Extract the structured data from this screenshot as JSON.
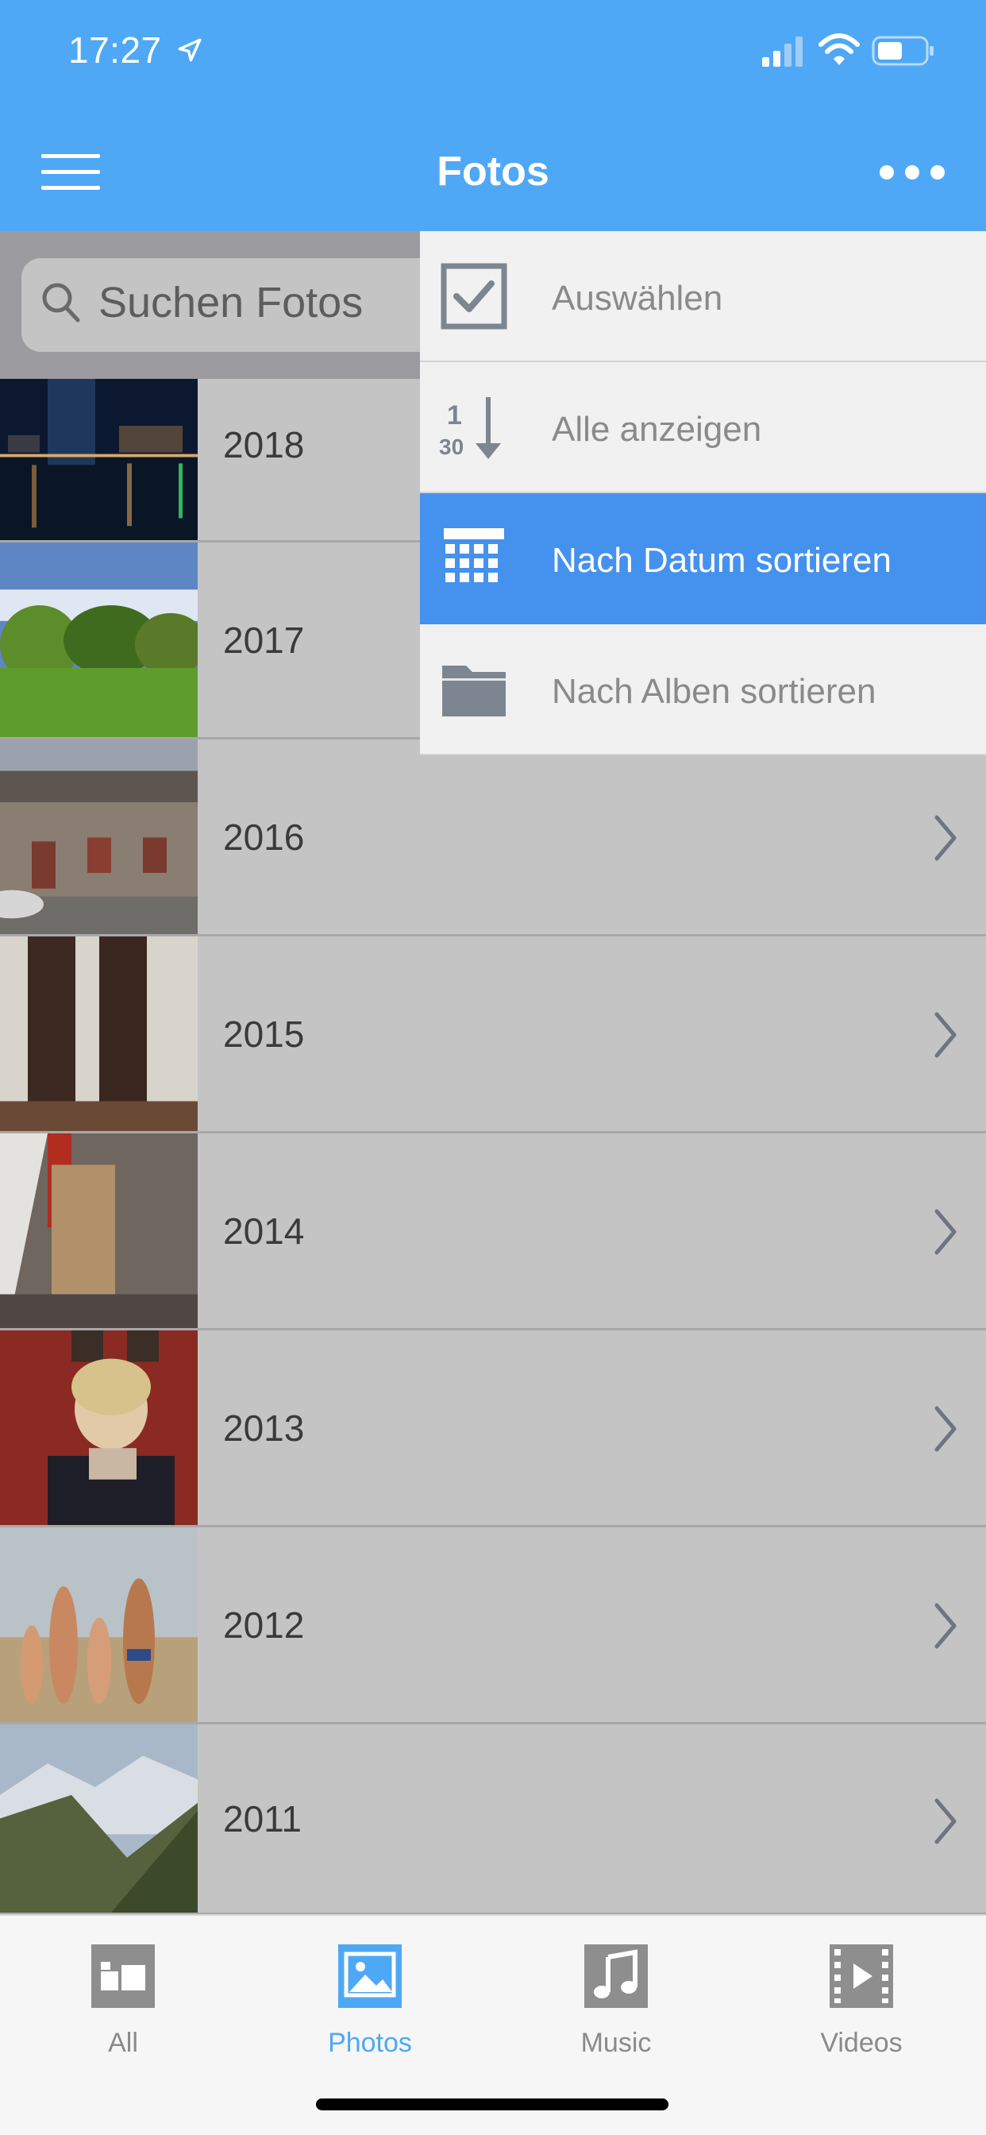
{
  "status": {
    "time": "17:27"
  },
  "nav": {
    "title": "Fotos"
  },
  "search": {
    "placeholder": "Suchen Fotos"
  },
  "years": [
    "2018",
    "2017",
    "2016",
    "2015",
    "2014",
    "2013",
    "2012",
    "2011"
  ],
  "menu": {
    "items": [
      {
        "label": "Auswählen",
        "icon": "checkbox-icon"
      },
      {
        "label": "Alle anzeigen",
        "icon": "sort-1-30-icon"
      },
      {
        "label": "Nach Datum sortieren",
        "icon": "calendar-icon",
        "active": true
      },
      {
        "label": "Nach Alben sortieren",
        "icon": "folder-icon"
      }
    ]
  },
  "tabs": [
    {
      "label": "All",
      "icon": "all-icon"
    },
    {
      "label": "Photos",
      "icon": "photo-icon",
      "active": true
    },
    {
      "label": "Music",
      "icon": "music-icon"
    },
    {
      "label": "Videos",
      "icon": "video-icon"
    }
  ],
  "colors": {
    "accent": "#4fa8f5",
    "menu_active": "#4591ee"
  }
}
